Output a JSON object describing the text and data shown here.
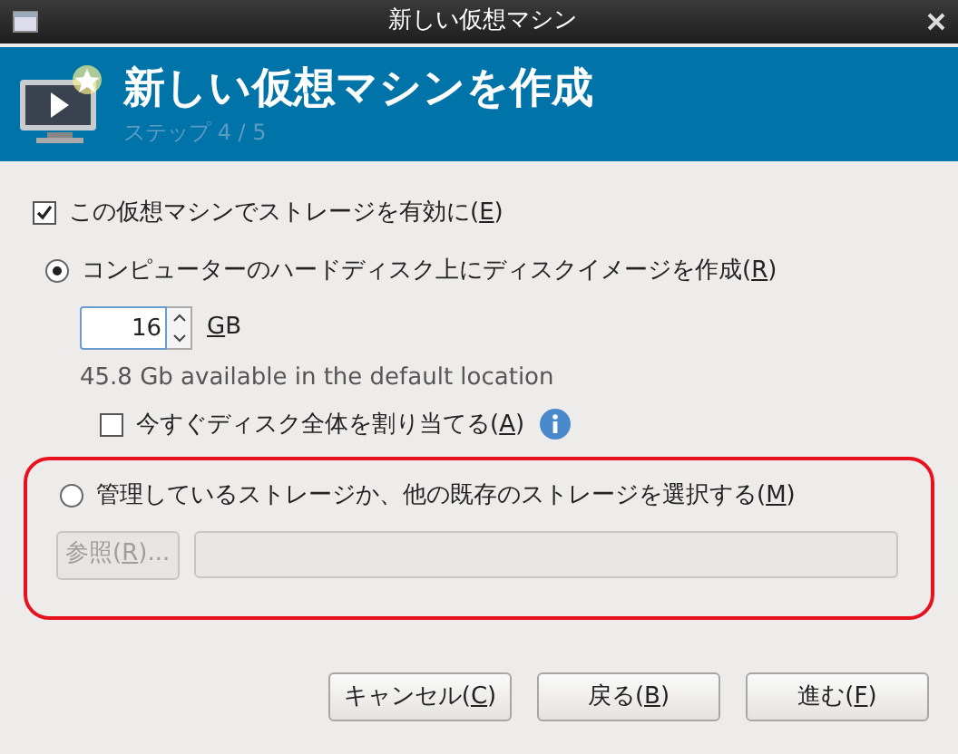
{
  "window": {
    "title": "新しい仮想マシン"
  },
  "header": {
    "title": "新しい仮想マシンを作成",
    "step": "ステップ 4 / 5"
  },
  "enable_storage": {
    "label": {
      "text": "この仮想マシンでストレージを有効に(",
      "key": "E",
      "end": ")"
    },
    "checked": true
  },
  "storage_options": [
    {
      "kind": "create",
      "selected": true,
      "label": {
        "text": "コンピューターのハードディスク上にディスクイメージを作成(",
        "key": "R",
        "end": ")"
      },
      "size_value": "16",
      "unit": {
        "key": "G",
        "end": "B"
      },
      "available": "45.8 Gb available in the default location",
      "allocate": {
        "label": {
          "text": "今すぐディスク全体を割り当てる(",
          "key": "A",
          "end": ")"
        },
        "checked": false
      }
    },
    {
      "kind": "existing",
      "selected": false,
      "label": {
        "text": "管理しているストレージか、他の既存のストレージを選択する(",
        "key": "M",
        "end": ")"
      },
      "browse": {
        "label": {
          "text": "参照(",
          "key": "R",
          "end": ")..."
        },
        "disabled": true
      },
      "path_disabled": true
    }
  ],
  "buttons": [
    {
      "text": "キャンセル(",
      "key": "C",
      "end": ")"
    },
    {
      "text": "戻る(",
      "key": "B",
      "end": ")"
    },
    {
      "text": "進む(",
      "key": "F",
      "end": ")"
    }
  ]
}
